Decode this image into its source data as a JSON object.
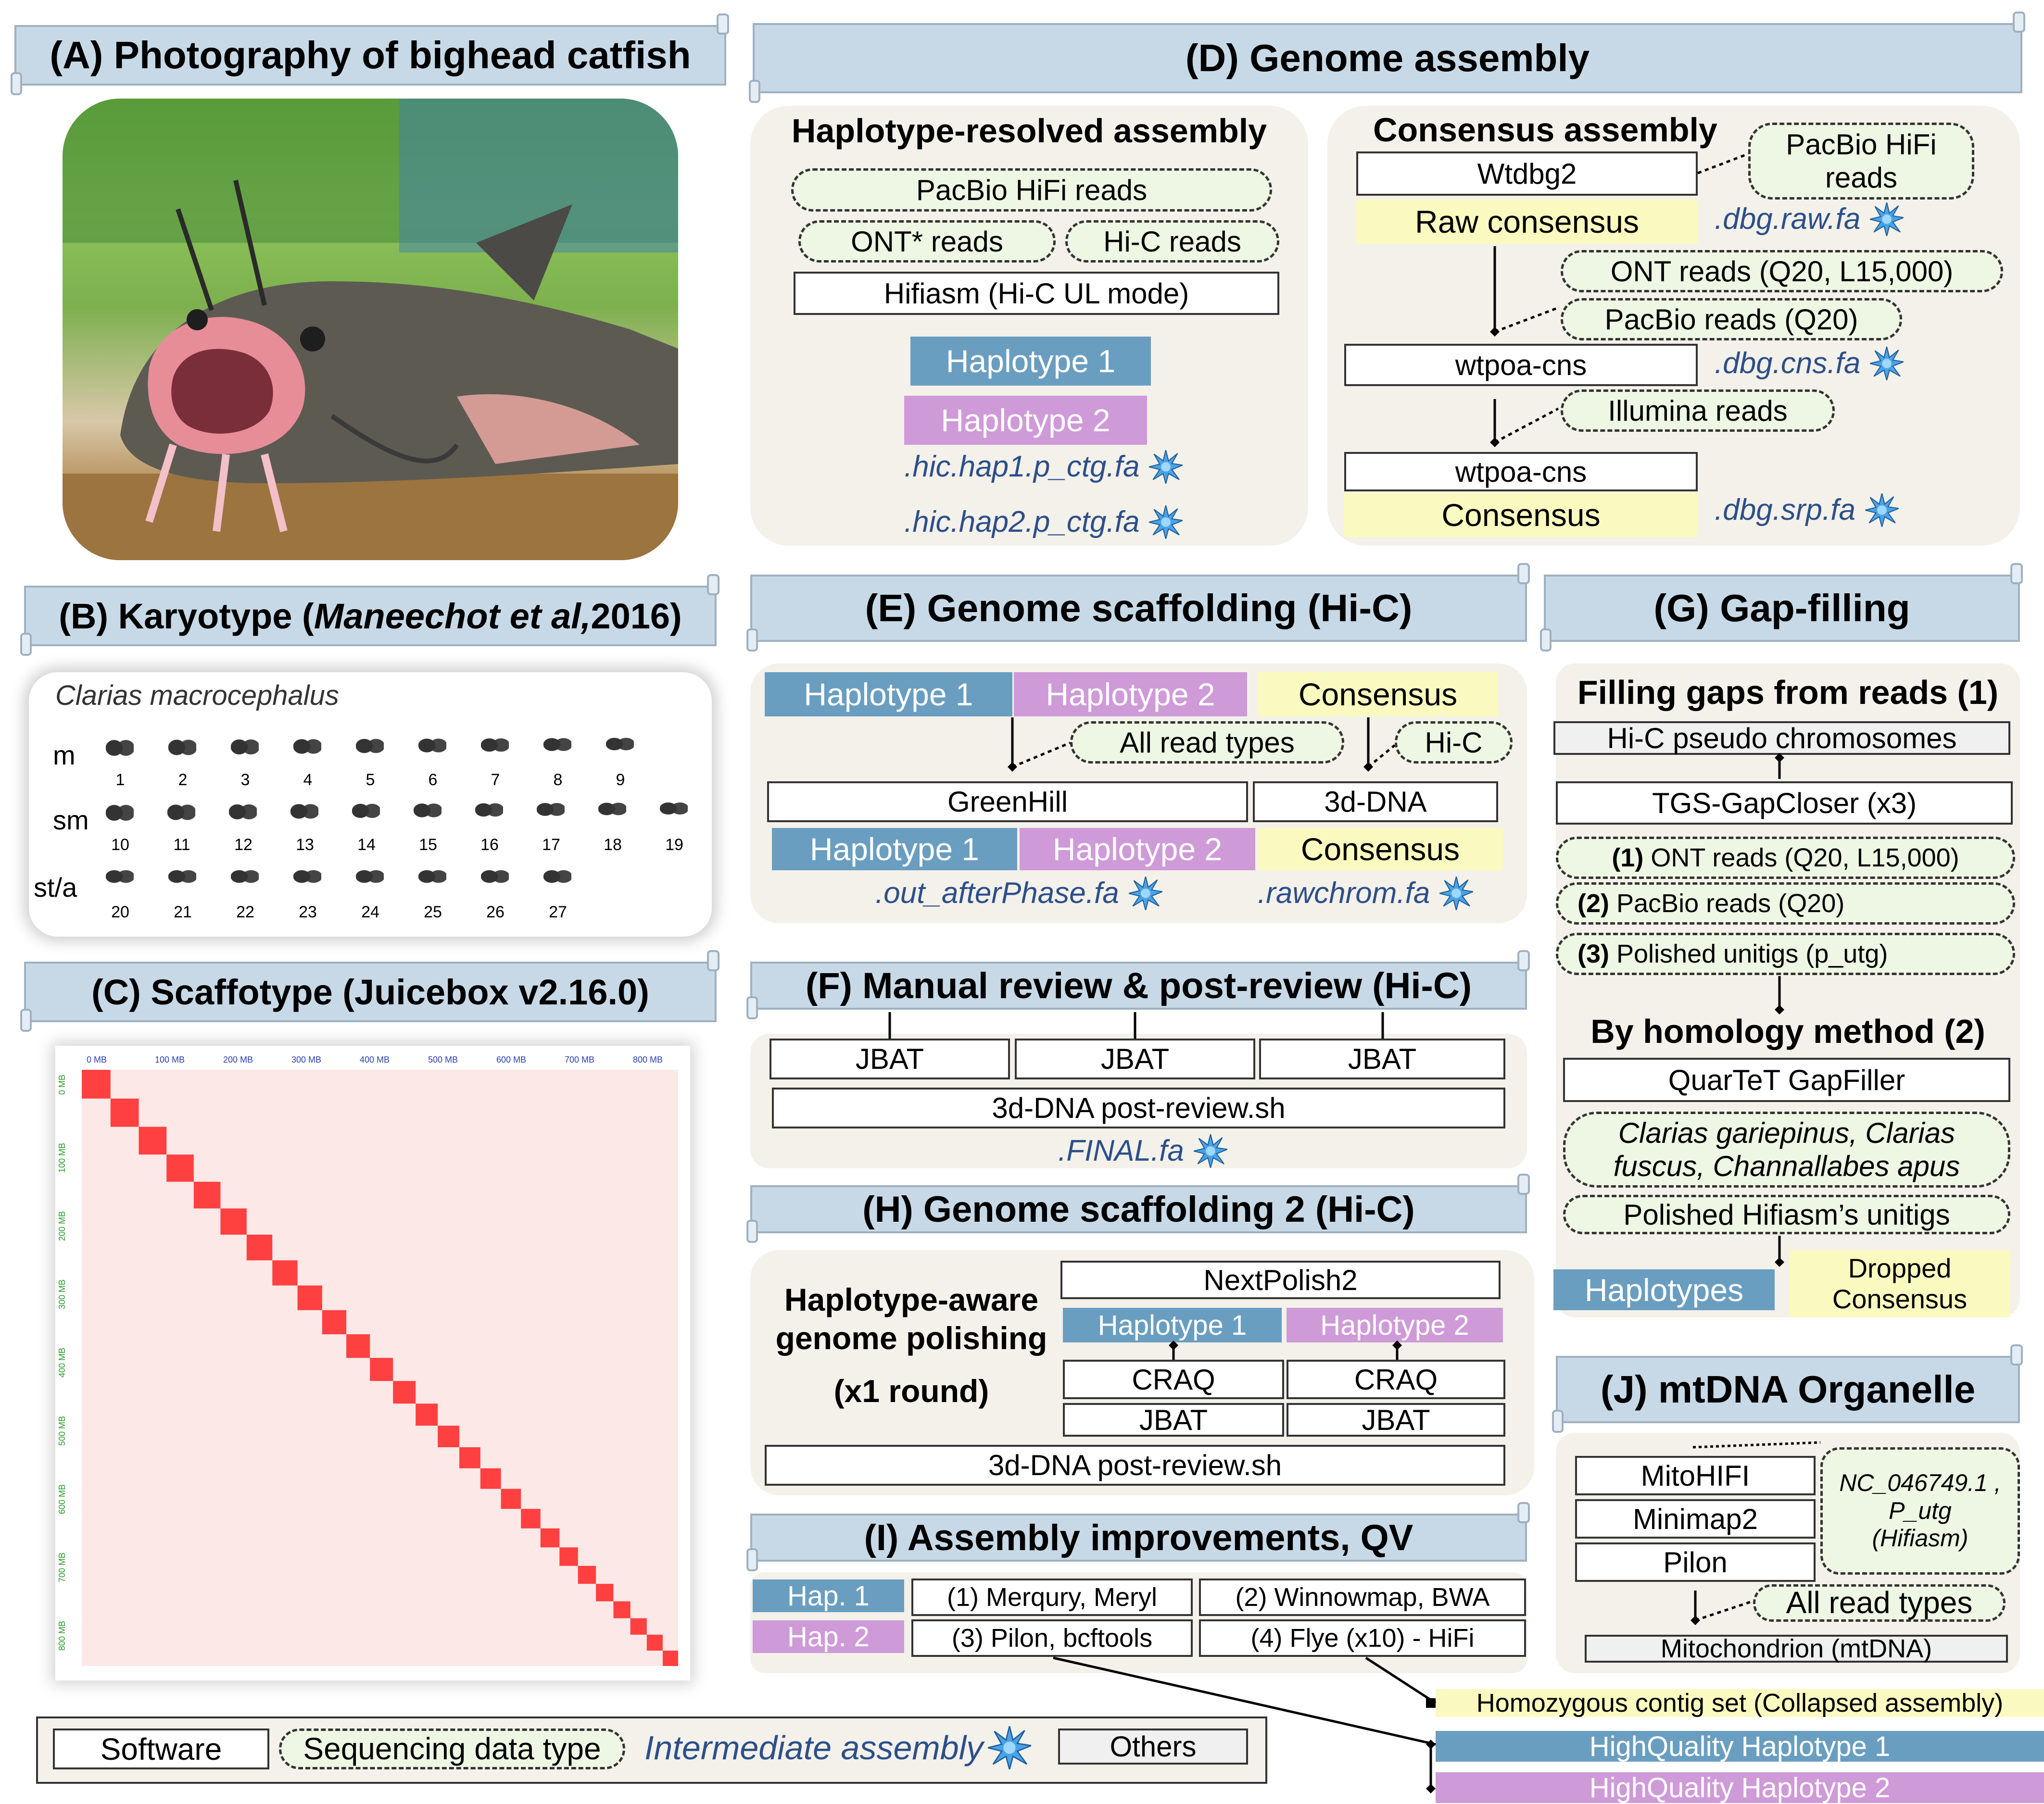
{
  "panels": {
    "A": {
      "title": "(A) Photography of bighead catfish"
    },
    "B": {
      "title_pre": "(B) Karyotype (",
      "title_cite": "Maneechot et al,",
      "title_post": " 2016)",
      "species": "Clarias macrocephalus",
      "rows": [
        {
          "label": "m",
          "nums": [
            "1",
            "2",
            "3",
            "4",
            "5",
            "6",
            "7",
            "8",
            "9"
          ]
        },
        {
          "label": "sm",
          "nums": [
            "10",
            "11",
            "12",
            "13",
            "14",
            "15",
            "16",
            "17",
            "18",
            "19"
          ]
        },
        {
          "label": "st/a",
          "nums": [
            "20",
            "21",
            "22",
            "23",
            "24",
            "25",
            "26",
            "27"
          ]
        }
      ]
    },
    "C": {
      "title": "(C) Scaffotype (Juicebox v2.16.0)",
      "xticks": [
        "0 MB",
        "100 MB",
        "200 MB",
        "300 MB",
        "400 MB",
        "500 MB",
        "600 MB",
        "700 MB",
        "800 MB"
      ],
      "yticks": [
        "0 MB",
        "100 MB",
        "200 MB",
        "300 MB",
        "400 MB",
        "500 MB",
        "600 MB",
        "700 MB",
        "800 MB"
      ]
    },
    "D": {
      "title": "(D) Genome assembly",
      "hap_title": "Haplotype-resolved assembly",
      "hifi": "PacBio HiFi reads",
      "ont": "ONT* reads",
      "hic": "Hi-C reads",
      "hifiasm": "Hifiasm (Hi-C UL mode)",
      "hap1": "Haplotype 1",
      "hap2": "Haplotype 2",
      "out1": ".hic.hap1.p_ctg.fa",
      "out2": ".hic.hap2.p_ctg.fa",
      "cons_title": "Consensus assembly",
      "wtdbg2": "Wtdbg2",
      "hifi2": "PacBio HiFi reads",
      "raw": "Raw consensus",
      "raw_out": ".dbg.raw.fa",
      "ont2": "ONT reads (Q20, L15,000)",
      "pacbio2": "PacBio reads (Q20)",
      "wtpoa1": "wtpoa-cns",
      "cns_out": ".dbg.cns.fa",
      "illumina": "Illumina reads",
      "wtpoa2": "wtpoa-cns",
      "consensus": "Consensus",
      "srp_out": ".dbg.srp.fa"
    },
    "E": {
      "title": "(E) Genome scaffolding (Hi-C)",
      "hap1": "Haplotype 1",
      "hap2": "Haplotype 2",
      "cons": "Consensus",
      "all_reads": "All read types",
      "hic": "Hi-C",
      "greenhill": "GreenHill",
      "dna3d": "3d-DNA",
      "out1": ".out_afterPhase.fa",
      "out2": ".rawchrom.fa"
    },
    "F": {
      "title": "(F) Manual review & post-review (Hi-C)",
      "jbat": "JBAT",
      "post": "3d-DNA post-review.sh",
      "final": ".FINAL.fa"
    },
    "G": {
      "title": "(G) Gap-filling",
      "sub1": "Filling gaps from reads (1)",
      "pseudo": "Hi-C pseudo chromosomes",
      "tgs": "TGS-GapCloser (x3)",
      "r1_num": "(1)",
      "r1": " ONT reads (Q20, L15,000)",
      "r2_num": "(2)",
      "r2": " PacBio reads (Q20)",
      "r3_num": "(3)",
      "r3": " Polished unitigs (p_utg)",
      "sub2": "By homology method (2)",
      "quartet": "QuarTeT GapFiller",
      "species": "Clarias gariepinus, Clarias fuscus, Channallabes apus",
      "unitigs": "Polished Hifiasm’s unitigs",
      "haplotypes": "Haplotypes",
      "dropped": "Dropped Consensus"
    },
    "H": {
      "title": "(H) Genome scaffolding 2 (Hi-C)",
      "label1": "Haplotype-aware",
      "label2": "genome polishing",
      "label3": "(x1 round)",
      "nextpolish": "NextPolish2",
      "hap1": "Haplotype 1",
      "hap2": "Haplotype 2",
      "craq": "CRAQ",
      "jbat": "JBAT",
      "post": "3d-DNA post-review.sh"
    },
    "I": {
      "title": "(I) Assembly improvements, QV",
      "hap1": "Hap. 1",
      "hap2": "Hap. 2",
      "t1": "(1) Merqury, Meryl",
      "t2": "(2) Winnowmap, BWA",
      "t3": "(3) Pilon, bcftools",
      "t4": "(4) Flye (x10) - HiFi"
    },
    "J": {
      "title": "(J) mtDNA Organelle",
      "mitohifi": "MitoHIFI",
      "minimap2": "Minimap2",
      "pilon": "Pilon",
      "ref1": "NC_046749.1 ,",
      "ref2": "P_utg",
      "ref3": "(Hifiasm)",
      "all_reads": "All read types",
      "mito": "Mitochondrion (mtDNA)"
    }
  },
  "outputs": {
    "homo": "Homozygous contig set (Collapsed assembly)",
    "hq1": "HighQuality Haplotype 1",
    "hq2": "HighQuality Haplotype 2"
  },
  "legend": {
    "software": "Software",
    "seq": "Sequencing data type",
    "inter": "Intermediate assembly",
    "others": "Others"
  },
  "colors": {
    "header": "#c7d9e6",
    "hap1": "#6a9ec0",
    "hap2": "#cf9ad8",
    "consensus": "#fafac0",
    "panel": "#f4f1ea",
    "seq": "#eef6e4",
    "intermediate": "#2c4f8a"
  }
}
